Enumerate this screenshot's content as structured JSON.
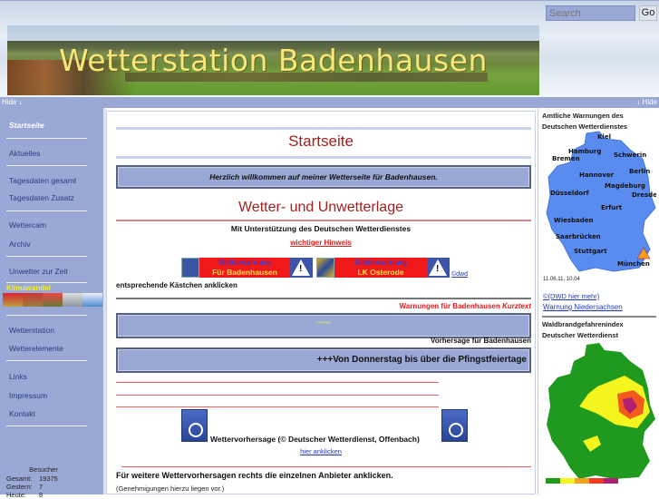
{
  "header": {
    "banner_title": "Wetterstation Badenhausen",
    "search_placeholder": "Search",
    "go_label": "Go",
    "hide_left": "Hide ↓",
    "hide_right": "↓ Hide"
  },
  "sidebar": {
    "items": [
      {
        "label": "Startseite",
        "active": true
      },
      {
        "label": "Aktuelles"
      },
      {
        "label": "Tagesdaten gesamt"
      },
      {
        "label": "Tagesdaten Zusatz"
      },
      {
        "label": "Wettercam"
      },
      {
        "label": "Archiv"
      },
      {
        "label": "Unwetter zur Zeit"
      },
      {
        "label": "Wetterstation"
      },
      {
        "label": "Wetterelemente"
      },
      {
        "label": "Links"
      },
      {
        "label": "Impressum"
      },
      {
        "label": "Kontakt"
      }
    ],
    "klima_label": "Klimawandel",
    "visitors": {
      "title": "Besucher",
      "rows": [
        {
          "label": "Gesamt:",
          "value": "19375"
        },
        {
          "label": "Gestern:",
          "value": "7"
        },
        {
          "label": "Heute:",
          "value": "8"
        }
      ]
    }
  },
  "main": {
    "page_title": "Startseite",
    "welcome": "Herzlich willkommen auf meiner Wetterseite für Badenhausen.",
    "section_title": "Wetter- und Unwetterlage",
    "support": "Mit Unterstützung des Deutschen Wetterdienstes",
    "hint_link": "wichtiger Hinweis",
    "warn_banners": [
      {
        "line1": "Wetterwarnung",
        "line2": "Für Badenhausen"
      },
      {
        "line1": "Wetterwarnung",
        "line2": "LK Osterode"
      }
    ],
    "dwd_link": "©dwd",
    "click_note": "entsprechende Kästchen anklicken",
    "kurztext_label": "Warnungen für Badenhausen",
    "kurztext_italic": "Kurztext",
    "warn_text": "******",
    "forecast_label": "Vorhersage für Badenhausen",
    "forecast_text": "+++Von Donnerstag bis über die Pfingstfeiertage",
    "dwd_forecast": "Wettervorhersage (© Deutscher Wetterdienst, Offenbach)",
    "here_link": "hier anklicken",
    "more_forecasts": "Für weitere Wettervorhersagen rechts die einzelnen Anbieter anklicken.",
    "permission": "(Genehmigungen hierzu liegen vor.)"
  },
  "right": {
    "warn_heading": "Amtliche Warnungen des Deutschen Wetterdienstes",
    "map_date": "11.06.11, 10.04",
    "cities": [
      "Kiel",
      "Hamburg",
      "Schwerin",
      "Bremen",
      "Hannover",
      "Berlin",
      "Magdeburg",
      "Düsseldorf",
      "Dresden",
      "Erfurt",
      "Wiesbaden",
      "Saarbrücken",
      "Stuttgart",
      "München"
    ],
    "dwd_more": "©(DWD hier mehr)",
    "warn_nds": "Warnung Niedersachsen",
    "fire_heading": "Waldbrandgefahrenindex Deutscher Wetterdienst",
    "fire_legend_colors": [
      "#1f9a1f",
      "#f4f41e",
      "#f4a21e",
      "#f43a1e",
      "#b0206e"
    ]
  }
}
